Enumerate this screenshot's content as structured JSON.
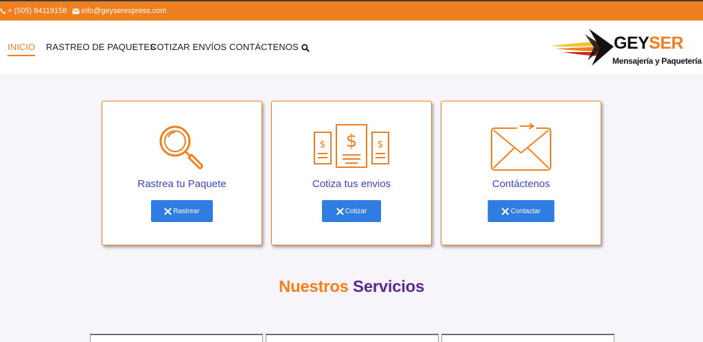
{
  "topbar": {
    "phone": "+ (505) 84119158",
    "email": "info@geyserexpress.com",
    "icons": [
      "phone-icon",
      "envelope-icon"
    ]
  },
  "nav": {
    "items": [
      {
        "label": "INICIO",
        "active": true
      },
      {
        "label": "RASTREO DE PAQUETES",
        "active": false
      },
      {
        "label": "COTIZAR ENVÍOS",
        "active": false
      },
      {
        "label": "CONTÁCTENOS",
        "active": false
      }
    ],
    "search_icon": "search-icon"
  },
  "logo": {
    "brand_part1": "GEY",
    "brand_part2": "SER",
    "tagline": "Mensajería y Paquetería"
  },
  "cards": [
    {
      "title": "Rastrea tu Paquete",
      "button": "Rastrear",
      "icon": "magnifier-icon"
    },
    {
      "title": "Cotiza tus envios",
      "button": "Cotizar",
      "icon": "invoice-icon"
    },
    {
      "title": "Contáctenos",
      "button": "Contactar",
      "icon": "envelope-icon"
    }
  ],
  "section": {
    "title_part1": "Nuestros",
    "title_part2": "Servicios"
  },
  "colors": {
    "accent_orange": "#ef7f1f",
    "button_blue": "#2f7de1",
    "card_title_blue": "#3a44c8",
    "services_purple": "#5b2a91"
  }
}
